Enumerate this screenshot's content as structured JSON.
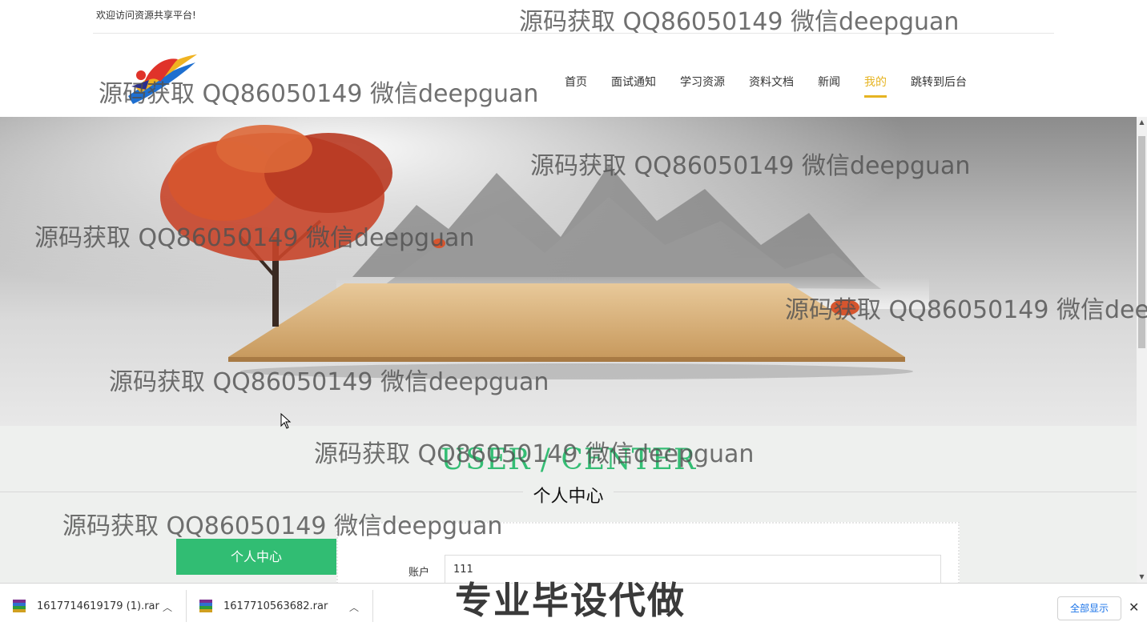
{
  "topbar": {
    "welcome": "欢迎访问资源共享平台!"
  },
  "nav": {
    "items": [
      {
        "label": "首页"
      },
      {
        "label": "面试通知"
      },
      {
        "label": "学习资源"
      },
      {
        "label": "资料文档"
      },
      {
        "label": "新闻"
      },
      {
        "label": "我的"
      },
      {
        "label": "跳转到后台"
      }
    ],
    "active_index": 5
  },
  "section": {
    "title_en": "USER / CENTER",
    "title_cn": "个人中心",
    "side_button": "个人中心",
    "account_label": "账户",
    "account_value": "111"
  },
  "watermark": {
    "text": "源码获取 QQ86050149 微信deepguan",
    "promo": "专业毕设代做"
  },
  "downloads": {
    "items": [
      {
        "name": "1617714619179 (1).rar"
      },
      {
        "name": "1617710563682.rar"
      }
    ],
    "show_all": "全部显示"
  },
  "colors": {
    "accent_green": "#31bd73",
    "nav_active": "#e6b422",
    "link_blue": "#1a73e8"
  },
  "icons": {
    "download_file": "rar-archive-icon",
    "expand": "chevron-up-icon",
    "close": "close-icon"
  }
}
